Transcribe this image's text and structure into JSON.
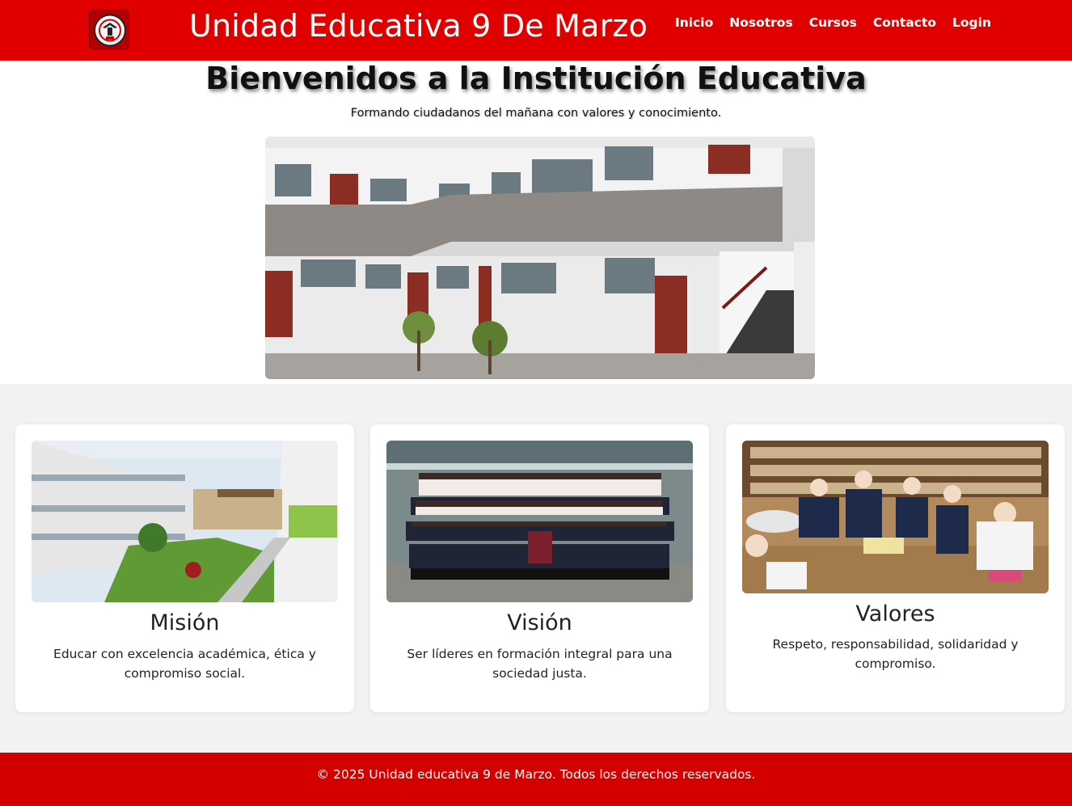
{
  "header": {
    "logo_icon": "school-crest-icon",
    "title": "Unidad Educativa 9 De Marzo",
    "nav": [
      {
        "label": "Inicio"
      },
      {
        "label": "Nosotros"
      },
      {
        "label": "Cursos"
      },
      {
        "label": "Contacto"
      },
      {
        "label": "Login"
      }
    ]
  },
  "hero": {
    "title": "Bienvenidos a la Institución Educativa",
    "subtitle": "Formando ciudadanos del mañana con valores y conocimiento."
  },
  "cards": [
    {
      "title": "Misión",
      "text": "Educar con excelencia académica, ética y compromiso social."
    },
    {
      "title": "Visión",
      "text": "Ser líderes en formación integral para una sociedad justa."
    },
    {
      "title": "Valores",
      "text": "Respeto, responsabilidad, solidaridad y compromiso."
    }
  ],
  "footer": {
    "text": "© 2025 Unidad educativa 9 de Marzo. Todos los derechos reservados."
  },
  "colors": {
    "brand_red": "#e00000",
    "footer_red": "#d40000",
    "section_bg": "#f2f2f2"
  }
}
